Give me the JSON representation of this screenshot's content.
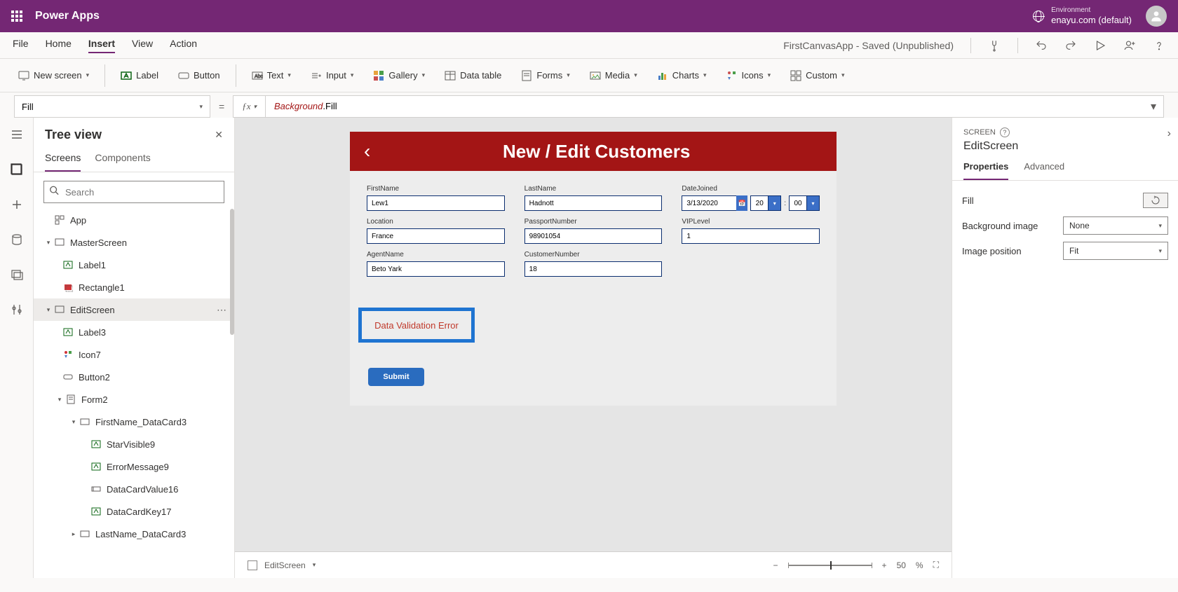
{
  "header": {
    "app_name": "Power Apps",
    "environment_label": "Environment",
    "environment_value": "enayu.com (default)"
  },
  "menu": {
    "items": [
      "File",
      "Home",
      "Insert",
      "View",
      "Action"
    ],
    "active_index": 2,
    "saved_text": "FirstCanvasApp - Saved (Unpublished)"
  },
  "ribbon": {
    "new_screen": "New screen",
    "label": "Label",
    "button": "Button",
    "text": "Text",
    "input": "Input",
    "gallery": "Gallery",
    "data_table": "Data table",
    "forms": "Forms",
    "media": "Media",
    "charts": "Charts",
    "icons": "Icons",
    "custom": "Custom"
  },
  "formula": {
    "property": "Fill",
    "obj": "Background",
    "prop": "Fill"
  },
  "tree": {
    "title": "Tree view",
    "tabs": [
      "Screens",
      "Components"
    ],
    "active_tab": 0,
    "search_placeholder": "Search",
    "nodes": {
      "app": "App",
      "master": "MasterScreen",
      "label1": "Label1",
      "rect1": "Rectangle1",
      "editscreen": "EditScreen",
      "label3": "Label3",
      "icon7": "Icon7",
      "button2": "Button2",
      "form2": "Form2",
      "fn_dc": "FirstName_DataCard3",
      "star9": "StarVisible9",
      "err9": "ErrorMessage9",
      "dcv16": "DataCardValue16",
      "dck17": "DataCardKey17",
      "ln_dc": "LastName_DataCard3"
    }
  },
  "canvas": {
    "title": "New / Edit Customers",
    "fields": {
      "first_name": {
        "label": "FirstName",
        "value": "Lew1"
      },
      "last_name": {
        "label": "LastName",
        "value": "Hadnott"
      },
      "date_joined": {
        "label": "DateJoined",
        "date": "3/13/2020",
        "hour": "20",
        "minute": "00"
      },
      "location": {
        "label": "Location",
        "value": "France"
      },
      "passport": {
        "label": "PassportNumber",
        "value": "98901054"
      },
      "vip": {
        "label": "VIPLevel",
        "value": "1"
      },
      "agent": {
        "label": "AgentName",
        "value": "Beto Yark"
      },
      "custno": {
        "label": "CustomerNumber",
        "value": "18"
      }
    },
    "validation_text": "Data Validation Error",
    "submit_text": "Submit"
  },
  "footer": {
    "breadcrumb": "EditScreen",
    "zoom_value": "50",
    "zoom_unit": "%"
  },
  "properties": {
    "kind": "SCREEN",
    "name": "EditScreen",
    "tabs": [
      "Properties",
      "Advanced"
    ],
    "active_tab": 0,
    "rows": {
      "fill": "Fill",
      "bg_image": {
        "label": "Background image",
        "value": "None"
      },
      "img_pos": {
        "label": "Image position",
        "value": "Fit"
      }
    }
  }
}
